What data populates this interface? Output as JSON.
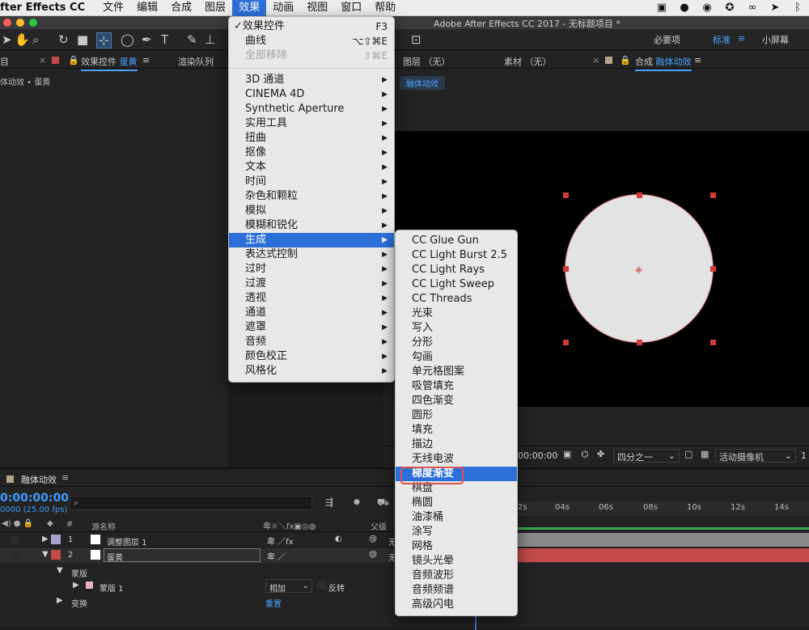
{
  "mac_menubar": {
    "app_name": "fter Effects CC",
    "items": [
      "文件",
      "编辑",
      "合成",
      "图层",
      "效果",
      "动画",
      "视图",
      "窗口",
      "帮助"
    ],
    "active_item": "效果"
  },
  "window": {
    "title": "Adobe After Effects CC 2017 - 无标题项目 *"
  },
  "workspaces": {
    "items": [
      "必要项",
      "标准",
      "小屏幕"
    ],
    "active": "标准"
  },
  "left_panel": {
    "tab_project": "目",
    "tab_effects": "效果控件",
    "tab_effects_layer": "蛋黄",
    "tab_render": "渲染队列",
    "breadcrumb": "体动效 • 蛋黄"
  },
  "viewer": {
    "tab_layer": "图层 （无）",
    "tab_footage": "素材 （无）",
    "tab_comp_prefix": "合成",
    "tab_comp_name": "融体动效",
    "comp_label": "融体动效",
    "timecode": "00:00:00",
    "resolution": "四分之一",
    "camera": "活动摄像机",
    "extra": "1"
  },
  "timeline": {
    "tab_name": "融体动效",
    "timecode": "0:00:00:00",
    "fps": "0000 (25.00 fps)",
    "col_hash": "#",
    "col_source": "源名称",
    "col_parent": "父级",
    "ruler": [
      "2s",
      "04s",
      "06s",
      "08s",
      "10s",
      "12s",
      "14s"
    ],
    "layers": [
      {
        "num": "1",
        "name": "调整图层 1",
        "parent": "无"
      },
      {
        "num": "2",
        "name": "蛋黄",
        "parent": "无"
      }
    ],
    "mask_group": "蒙版",
    "mask_name": "蒙版 1",
    "mask_mode": "相加",
    "mask_invert": "反转",
    "transform": "变换",
    "reset": "重置"
  },
  "effects_menu": {
    "top": [
      {
        "label": "效果控件",
        "shortcut": "F3",
        "checked": true
      },
      {
        "label": "曲线",
        "shortcut": "⌥⇧⌘E"
      },
      {
        "label": "全部移除",
        "shortcut": "⇧⌘E",
        "disabled": true
      }
    ],
    "categories": [
      "3D 通道",
      "CINEMA 4D",
      "Synthetic Aperture",
      "实用工具",
      "扭曲",
      "抠像",
      "文本",
      "时间",
      "杂色和颗粒",
      "模拟",
      "模糊和锐化",
      "生成",
      "表达式控制",
      "过时",
      "过渡",
      "透视",
      "通道",
      "遮罩",
      "音频",
      "颜色校正",
      "风格化"
    ],
    "highlighted": "生成"
  },
  "generate_submenu": {
    "items": [
      "CC Glue Gun",
      "CC Light Burst 2.5",
      "CC Light Rays",
      "CC Light Sweep",
      "CC Threads",
      "光束",
      "写入",
      "分形",
      "勾画",
      "单元格图案",
      "吸管填充",
      "四色渐变",
      "圆形",
      "填充",
      "描边",
      "无线电波",
      "梯度渐变",
      "棋盘",
      "椭圆",
      "油漆桶",
      "涂写",
      "网格",
      "镜头光晕",
      "音频波形",
      "音频频谱",
      "高级闪电"
    ],
    "highlighted": "梯度渐变"
  },
  "colors": {
    "accent": "#2c6fd8",
    "timecode_blue": "#3f9bff",
    "layer_red": "#c44a4a",
    "highlight_box": "#d9534f"
  }
}
